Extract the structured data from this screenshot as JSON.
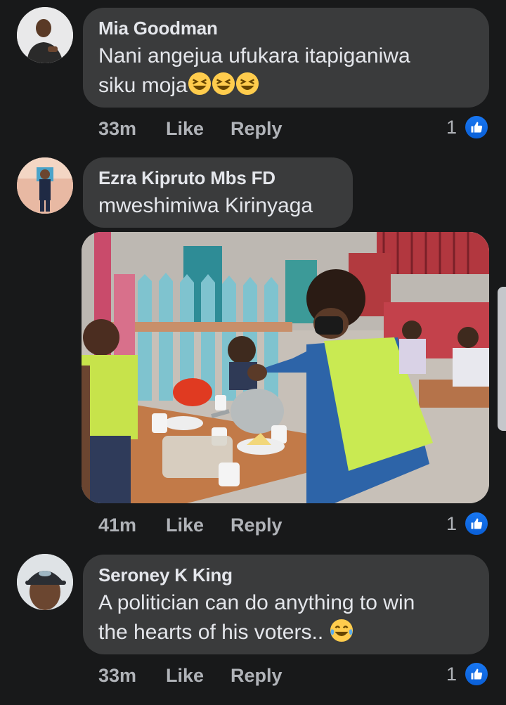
{
  "comments": [
    {
      "author": "Mia Goodman",
      "text_line1": "Nani angejua ufukara itapiganiwa",
      "text_line2": "siku moja",
      "time": "33m",
      "like_label": "Like",
      "reply_label": "Reply",
      "reaction_count": "1"
    },
    {
      "author": "Ezra Kipruto Mbs FD",
      "text_line1": "mweshimiwa Kirinyaga",
      "time": "41m",
      "like_label": "Like",
      "reply_label": "Reply",
      "reaction_count": "1"
    },
    {
      "author": "Seroney K King",
      "text_line1": "A politician can do anything to win",
      "text_line2": "the hearts of his voters..",
      "time": "33m",
      "like_label": "Like",
      "reply_label": "Reply",
      "reaction_count": "1"
    }
  ],
  "colors": {
    "background": "#18191a",
    "bubble": "#3a3b3c",
    "like_blue": "#1877f2",
    "muted_text": "#b0b3b8"
  },
  "icons": [
    "thumbs-up-icon",
    "laughing-emoji-icon",
    "tears-of-joy-emoji-icon"
  ]
}
